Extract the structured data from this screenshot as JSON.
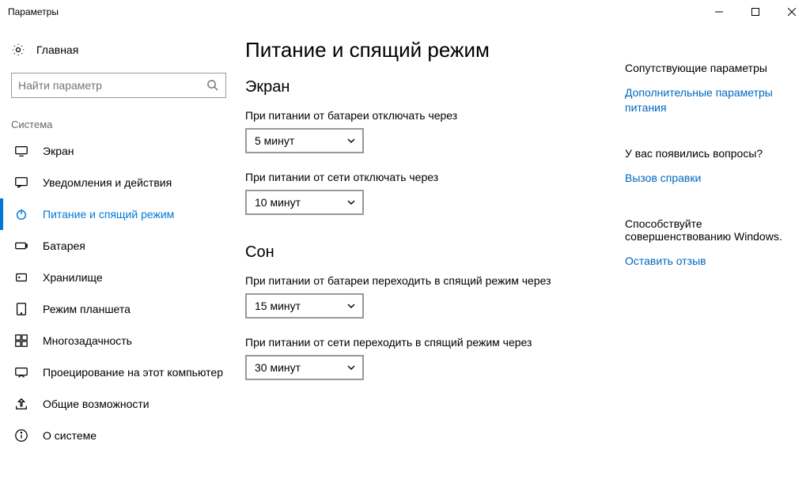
{
  "window": {
    "title": "Параметры"
  },
  "sidebar": {
    "home_label": "Главная",
    "search_placeholder": "Найти параметр",
    "group_label": "Система",
    "items": [
      {
        "label": "Экран"
      },
      {
        "label": "Уведомления и действия"
      },
      {
        "label": "Питание и спящий режим"
      },
      {
        "label": "Батарея"
      },
      {
        "label": "Хранилище"
      },
      {
        "label": "Режим планшета"
      },
      {
        "label": "Многозадачность"
      },
      {
        "label": "Проецирование на этот компьютер"
      },
      {
        "label": "Общие возможности"
      },
      {
        "label": "О системе"
      }
    ]
  },
  "main": {
    "title": "Питание и спящий режим",
    "section_screen": "Экран",
    "screen_battery_label": "При питании от батареи отключать через",
    "screen_battery_value": "5 минут",
    "screen_plugged_label": "При питании от сети отключать через",
    "screen_plugged_value": "10 минут",
    "section_sleep": "Сон",
    "sleep_battery_label": "При питании от батареи переходить в спящий режим через",
    "sleep_battery_value": "15 минут",
    "sleep_plugged_label": "При питании от сети переходить в спящий режим через",
    "sleep_plugged_value": "30 минут"
  },
  "right": {
    "related_heading": "Сопутствующие параметры",
    "related_link": "Дополнительные параметры питания",
    "questions_heading": "У вас появились вопросы?",
    "questions_link": "Вызов справки",
    "feedback_heading": "Способствуйте совершенствованию Windows.",
    "feedback_link": "Оставить отзыв"
  }
}
